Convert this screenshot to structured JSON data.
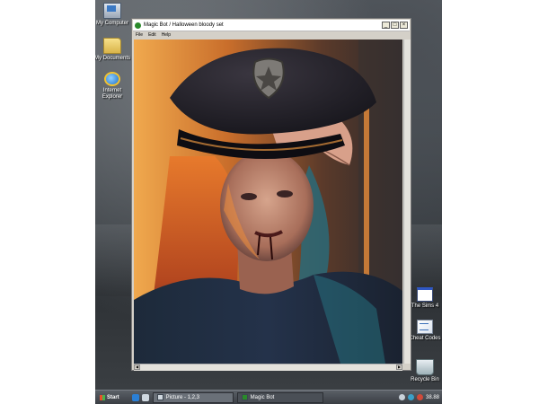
{
  "desktop": {
    "icons": [
      {
        "label": "My Computer",
        "icon": "computer-icon"
      },
      {
        "label": "My Documents",
        "icon": "folder-icon"
      },
      {
        "label": "Internet Explorer",
        "icon": "internet-explorer-icon"
      },
      {
        "label": "The Sims 4",
        "icon": "window-app-icon"
      },
      {
        "label": "Cheat Codes",
        "icon": "document-icon"
      },
      {
        "label": "Recycle Bin",
        "icon": "recycle-bin-icon"
      }
    ]
  },
  "window": {
    "title": "Magic Bot / Halloween bloody set",
    "controls": {
      "minimize": "_",
      "maximize": "□",
      "close": "×"
    },
    "menu": [
      "File",
      "Edit",
      "Help"
    ]
  },
  "taskbar": {
    "start_label": "Start",
    "tasks": [
      {
        "label": "Picture - 1,2,3"
      },
      {
        "label": "Magic Bot"
      }
    ],
    "clock": "38.88"
  },
  "colors": {
    "taskbar": "#3a3e44",
    "window_frame": "#d4d0c8",
    "accent_glow": "#e89a3c",
    "neon_teal": "#2fb0b8"
  }
}
